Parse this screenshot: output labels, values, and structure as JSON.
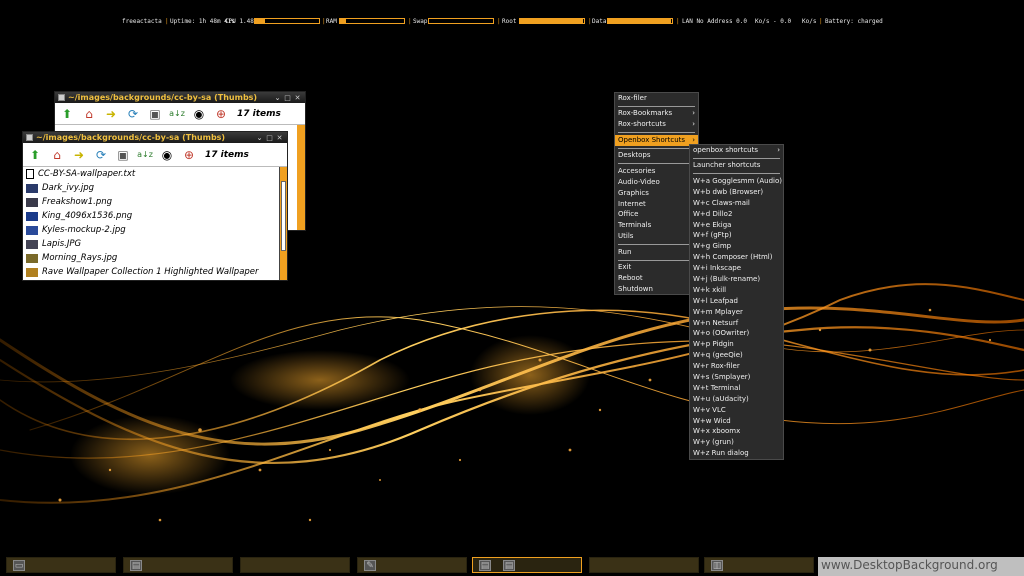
{
  "conky": {
    "hostname": "freeactacta",
    "uptime": "Uptime: 1h 48m 41s",
    "cpu_label": "CPU 1.48",
    "ram_label": "RAM",
    "swap_label": "Swap",
    "root_label": "Root",
    "data_label": "Data",
    "lan_label": "LAN No Address 0.0",
    "down_label": "Ko/s - 0.0",
    "up_label": "Ko/s",
    "battery": "Battery: charged",
    "cpu_usage": 0.15,
    "ram_usage": 0.1,
    "swap_usage": 0.0,
    "root_usage": 0.98,
    "data_usage": 0.98,
    "accent": "#f0a020"
  },
  "back_window": {
    "title": "~/images/backgrounds/cc-by-sa (Thumbs)",
    "items_count": "17 items"
  },
  "front_window": {
    "title": "~/images/backgrounds/cc-by-sa (Thumbs)",
    "items_count": "17 items",
    "files": [
      {
        "name": "CC-BY-SA-wallpaper.txt",
        "icon": "text-file-icon"
      },
      {
        "name": "Dark_ivy.jpg",
        "icon": "image-thumb-icon"
      },
      {
        "name": "Freakshow1.png",
        "icon": "image-thumb-icon"
      },
      {
        "name": "King_4096x1536.png",
        "icon": "image-thumb-icon"
      },
      {
        "name": "Kyles-mockup-2.jpg",
        "icon": "image-thumb-icon"
      },
      {
        "name": "Lapis.JPG",
        "icon": "image-thumb-icon"
      },
      {
        "name": "Morning_Rays.jpg",
        "icon": "image-thumb-icon"
      },
      {
        "name": "Rave Wallpaper Collection 1 Highlighted Wallpaper",
        "icon": "image-thumb-icon"
      }
    ]
  },
  "root_menu": {
    "rox_filer": "Rox-filer",
    "rox_bookmarks": "Rox-Bookmarks",
    "rox_shortcuts": "Rox-shortcuts",
    "openbox_shortcuts": "Openbox Shortcuts",
    "desktops": "Desktops",
    "accesories": "Accesories",
    "audio_video": "Audio-Video",
    "graphics": "Graphics",
    "internet": "Internet",
    "office": "Office",
    "terminals": "Terminals",
    "utils": "Utils",
    "run": "Run",
    "exit": "Exit",
    "reboot": "Reboot",
    "shutdown": "Shutdown",
    "submenu_arrow": "›"
  },
  "shortcuts_menu": {
    "openbox_shortcuts": "openbox shortcuts",
    "launcher_shortcuts": "Launcher shortcuts",
    "items": [
      "W+a Gogglesmm (Audio)",
      "W+b dwb (Browser)",
      "W+c Claws-mail",
      "W+d Dillo2",
      "W+e Ekiga",
      "W+f (gFtp)",
      "W+g Gimp",
      "W+h Composer (Html)",
      "W+i Inkscape",
      "W+j (Bulk-rename)",
      "W+k xkill",
      "W+l Leafpad",
      "W+m Mplayer",
      "W+n Netsurf",
      "W+o (OOwriter)",
      "W+p Pidgin",
      "W+q (geeQie)",
      "W+r Rox-filer",
      "W+s (Smplayer)",
      "W+t Terminal",
      "W+u (aUdacity)",
      "W+v VLC",
      "W+w Wicd",
      "W+x xboomx",
      "W+y (grun)",
      "W+z Run dialog"
    ]
  },
  "watermark": "www.DesktopBackground.org"
}
